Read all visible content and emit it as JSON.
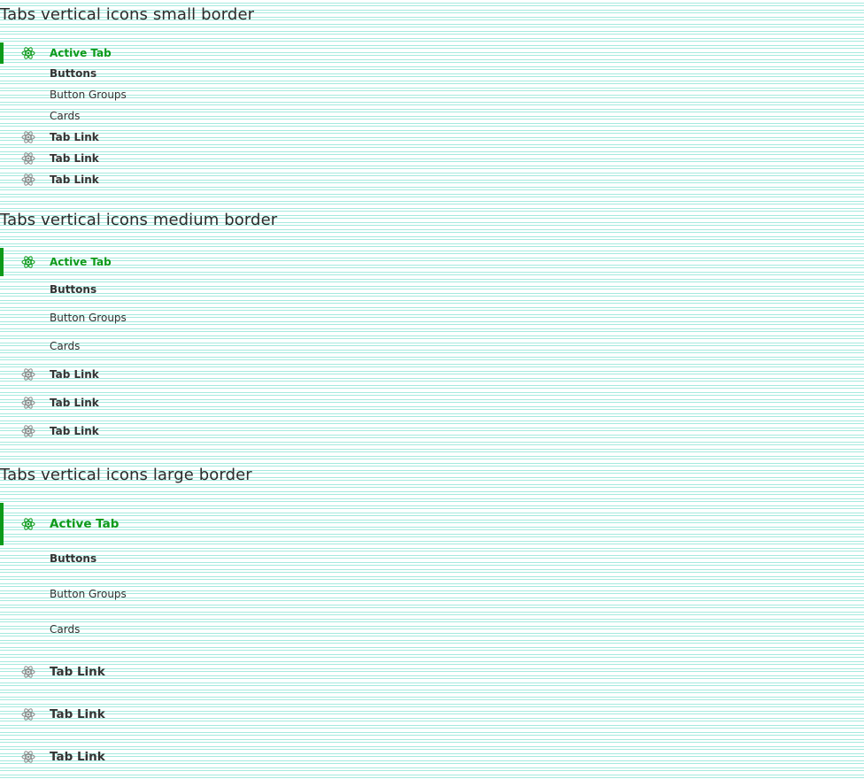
{
  "sections": [
    {
      "title": "Tabs vertical icons small border",
      "tabs": [
        {
          "label": "Active Tab",
          "icon": "atom-icon"
        },
        {
          "label": "Buttons"
        },
        {
          "label": "Button Groups"
        },
        {
          "label": "Cards"
        },
        {
          "label": "Tab Link",
          "icon": "atom-icon"
        },
        {
          "label": "Tab Link",
          "icon": "atom-icon"
        },
        {
          "label": "Tab Link",
          "icon": "atom-icon"
        }
      ]
    },
    {
      "title": "Tabs vertical icons medium border",
      "tabs": [
        {
          "label": "Active Tab",
          "icon": "atom-icon"
        },
        {
          "label": "Buttons"
        },
        {
          "label": "Button Groups"
        },
        {
          "label": "Cards"
        },
        {
          "label": "Tab Link",
          "icon": "atom-icon"
        },
        {
          "label": "Tab Link",
          "icon": "atom-icon"
        },
        {
          "label": "Tab Link",
          "icon": "atom-icon"
        }
      ]
    },
    {
      "title": "Tabs vertical icons large border",
      "tabs": [
        {
          "label": "Active Tab",
          "icon": "atom-icon"
        },
        {
          "label": "Buttons"
        },
        {
          "label": "Button Groups"
        },
        {
          "label": "Cards"
        },
        {
          "label": "Tab Link",
          "icon": "atom-icon"
        },
        {
          "label": "Tab Link",
          "icon": "atom-icon"
        },
        {
          "label": "Tab Link",
          "icon": "atom-icon"
        }
      ]
    }
  ],
  "colors": {
    "accent": "#0d9a1a",
    "icon_inactive": "#8a8a8a",
    "text": "#333333",
    "guide_lines": "#a5eade"
  }
}
